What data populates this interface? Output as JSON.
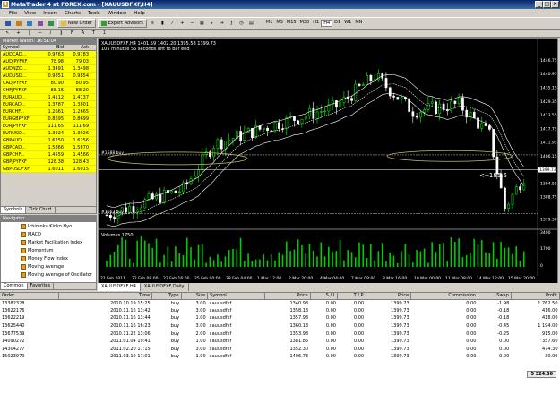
{
  "window": {
    "title": "MetaTrader 4 at FOREX.com - [XAUUSDFXF,H4]"
  },
  "menu": [
    "File",
    "View",
    "Insert",
    "Charts",
    "Tools",
    "Window",
    "Help"
  ],
  "toolbar": {
    "new_order": "New Order",
    "expert_advisors": "Expert Advisors",
    "timeframes": [
      "M1",
      "M5",
      "M15",
      "M30",
      "H1",
      "H4",
      "D1",
      "W1",
      "MN"
    ],
    "active_timeframe": "H4"
  },
  "market_watch": {
    "title": "Market Watch: 16:51:04",
    "headers": {
      "symbol": "Symbol",
      "bid": "Bid",
      "ask": "Ask"
    },
    "rows": [
      {
        "symbol": "AUDCAD...",
        "bid": "0.9763",
        "ask": "0.9783"
      },
      {
        "symbol": "AUDJPYFXF",
        "bid": "78.98",
        "ask": "79.03"
      },
      {
        "symbol": "AUDNZD...",
        "bid": "1.3491",
        "ask": "1.3498"
      },
      {
        "symbol": "AUDUSD...",
        "bid": "0.9851",
        "ask": "0.9854"
      },
      {
        "symbol": "CADJPYFXF",
        "bid": "80.90",
        "ask": "80.95"
      },
      {
        "symbol": "CHFJPYFXF",
        "bid": "88.16",
        "ask": "88.20"
      },
      {
        "symbol": "EURAUD...",
        "bid": "1.4112",
        "ask": "1.4137"
      },
      {
        "symbol": "EURCAD...",
        "bid": "1.3787",
        "ask": "1.3801"
      },
      {
        "symbol": "EURCHF...",
        "bid": "1.2661",
        "ask": "1.2665"
      },
      {
        "symbol": "EURGBPFXF",
        "bid": "0.8695",
        "ask": "0.8699"
      },
      {
        "symbol": "EURJPYFXF",
        "bid": "111.65",
        "ask": "111.69"
      },
      {
        "symbol": "EURUSD...",
        "bid": "1.3924",
        "ask": "1.3926"
      },
      {
        "symbol": "GBPAUD...",
        "bid": "1.6250",
        "ask": "1.6256"
      },
      {
        "symbol": "GBPCAD...",
        "bid": "1.5866",
        "ask": "1.5870"
      },
      {
        "symbol": "GBPCHF...",
        "bid": "1.4559",
        "ask": "1.4566"
      },
      {
        "symbol": "GBPJPYFXF",
        "bid": "128.38",
        "ask": "128.43"
      },
      {
        "symbol": "GBPUSDFXF",
        "bid": "1.6011",
        "ask": "1.6015"
      }
    ],
    "tabs": [
      "Symbols",
      "Tick Chart"
    ],
    "active_tab": "Symbols"
  },
  "navigator": {
    "title": "Navigator",
    "items": [
      "Ichimoku Kinko Hyo",
      "MACD",
      "Market Facilitation Index",
      "Momentum",
      "Money Flow Index",
      "Moving Average",
      "Moving Average of Oscillator"
    ],
    "tabs": [
      "Common",
      "Favorites"
    ],
    "active_tab": "Common"
  },
  "chart": {
    "header": "XAUUSDFXF,H4  1401.59 1402.20 1395.58 1399.73",
    "subheader": "105 minutes 55 seconds left to bar end",
    "line_labels": [
      "#1588 buy",
      "#1562 buy"
    ],
    "current_price": "1399.73",
    "arrow_label": "<--185.5",
    "volume_label": "Volumes 1750",
    "price_ticks": [
      "1446.75",
      "1440.95",
      "1435.15",
      "1429.35",
      "1423.55",
      "1417.75",
      "1411.95",
      "1406.15",
      "1400.35",
      "1394.55",
      "1388.75",
      "1379.30"
    ],
    "volume_ticks": [
      "3400",
      "1700",
      "0"
    ],
    "time_ticks": [
      "21 Feb 2011",
      "22 Feb 08:00",
      "23 Feb 16:00",
      "25 Feb 00:00",
      "28 Feb 04:00",
      "1 Mar 12:00",
      "2 Mar 20:00",
      "4 Mar 04:00",
      "7 Mar 08:00",
      "8 Mar 16:00",
      "10 Mar 00:00",
      "11 Mar 08:00",
      "14 Mar 12:00",
      "15 Mar 20:00"
    ],
    "tabs": [
      "XAUUSDFXF,H4",
      "XAUUSDFXF,Daily"
    ],
    "colors": {
      "bull": "#00ff00",
      "bear": "#ffffff",
      "background": "#000000",
      "volume": "#00cc00",
      "hline": "#c8c060"
    }
  },
  "terminal": {
    "headers": [
      "Order",
      "Time",
      "Type",
      "Size",
      "Symbol",
      "Price",
      "S / L",
      "T / P",
      "Price",
      "Commission",
      "Swap",
      "Profit"
    ],
    "rows": [
      [
        "13382328",
        "2010.10.19 15:25",
        "buy",
        "3.00",
        "xauusdfxf",
        "1340.98",
        "0.00",
        "0.00",
        "1399.73",
        "0.00",
        "-1.98",
        "1 762.50"
      ],
      [
        "13622176",
        "2010.11.16 13:42",
        "buy",
        "3.00",
        "xauusdfxf",
        "1358.13",
        "0.00",
        "0.00",
        "1399.73",
        "0.00",
        "-0.18",
        "416.00"
      ],
      [
        "13622219",
        "2010.11.16 13:44",
        "buy",
        "1.00",
        "xauusdfxf",
        "1357.93",
        "0.00",
        "0.00",
        "1399.73",
        "0.00",
        "-0.18",
        "418.00"
      ],
      [
        "13625440",
        "2010.11.16 16:23",
        "buy",
        "3.00",
        "xauusdfxf",
        "1360.13",
        "0.00",
        "0.00",
        "1399.73",
        "0.00",
        "-0.45",
        "1 194.00"
      ],
      [
        "13677539",
        "2010.11.22 13:06",
        "buy",
        "2.00",
        "xauusdfxf",
        "1353.98",
        "0.00",
        "0.00",
        "1399.73",
        "0.00",
        "-0.25",
        "915.00"
      ],
      [
        "14090272",
        "2011.01.04 19:41",
        "buy",
        "1.00",
        "xauusdfxf",
        "1381.85",
        "0.00",
        "0.00",
        "1399.73",
        "0.00",
        "0.00",
        "357.60"
      ],
      [
        "14304277",
        "2011.02.20 17:15",
        "buy",
        "3.00",
        "xauusdfxf",
        "1352.30",
        "0.00",
        "0.00",
        "1399.73",
        "0.00",
        "0.00",
        "474.30"
      ],
      [
        "15023979",
        "2011.03.10 17:01",
        "buy",
        "1.00",
        "xauusdfxf",
        "1406.73",
        "0.00",
        "0.00",
        "1399.73",
        "0.00",
        "0.00",
        "-30.00"
      ]
    ],
    "total": "5 324.36"
  }
}
